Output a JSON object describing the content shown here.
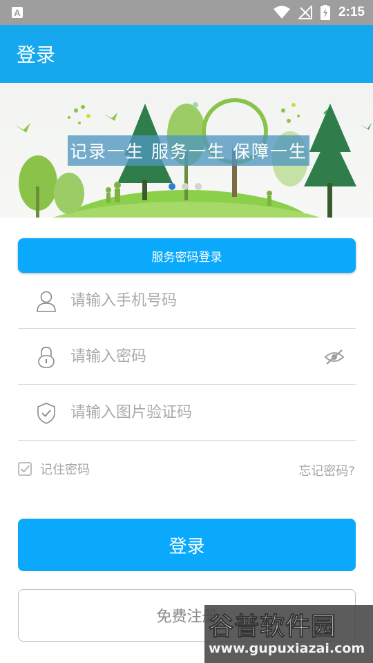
{
  "status_bar": {
    "time": "2:15",
    "icons": [
      "notification-a-icon",
      "wifi-icon",
      "no-signal-icon",
      "battery-charging-icon"
    ]
  },
  "app_bar": {
    "title": "登录"
  },
  "banner": {
    "slogan": "记录一生 服务一生 保障一生",
    "page_count": 3,
    "active_page": 1
  },
  "service_login": {
    "label": "服务密码登录"
  },
  "form": {
    "phone_placeholder": "请输入手机号码",
    "password_placeholder": "请输入密码",
    "captcha_placeholder": "请输入图片验证码"
  },
  "remember": {
    "label": "记住密码",
    "checked": true
  },
  "forgot_label": "忘记密码?",
  "buttons": {
    "login": "登录",
    "register": "免费注册"
  },
  "watermark": {
    "title": "谷普软件园",
    "url": "www.gupuxiazai.com"
  },
  "colors": {
    "primary": "#0aa9fb",
    "app_bar": "#16a8ee",
    "status_bar": "#9e9e9e",
    "placeholder": "#aaaaaa"
  }
}
